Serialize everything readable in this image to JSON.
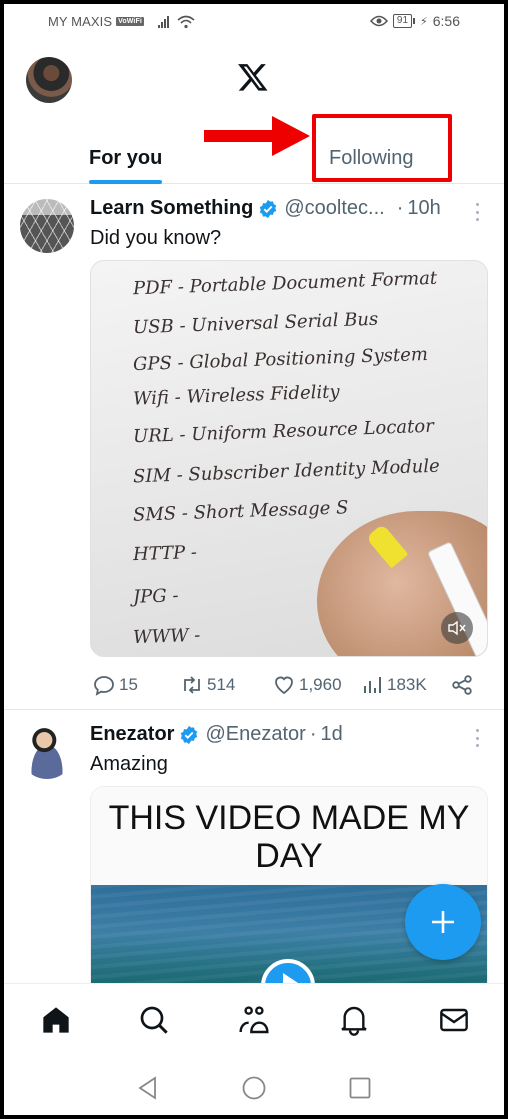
{
  "status_bar": {
    "carrier": "MY MAXIS",
    "vowifi_badge": "VoWiFi",
    "battery": "91",
    "time": "6:56"
  },
  "header": {
    "logo": "x-logo-icon",
    "tabs": [
      {
        "label": "For you",
        "active": true
      },
      {
        "label": "Following",
        "active": false,
        "highlighted": true
      }
    ],
    "annotation": {
      "arrow_color": "#ee0000",
      "box_color": "#ee0000"
    }
  },
  "tweets": [
    {
      "name": "Learn Something",
      "verified": true,
      "handle": "@cooltec...",
      "separator": "·",
      "time": "10h",
      "text": "Did you know?",
      "media": {
        "type": "video",
        "handwritten_lines": [
          "PDF - Portable Document Format",
          "USB - Universal Serial Bus",
          "GPS - Global Positioning System",
          "Wifi - Wireless Fidelity",
          "URL - Uniform Resource Locator",
          "SIM - Subscriber Identity Module",
          "SMS - Short Message S",
          "HTTP -",
          "JPG -",
          "WWW -"
        ],
        "muted": true
      },
      "actions": {
        "replies": "15",
        "reposts": "514",
        "likes": "1,960",
        "views": "183K"
      }
    },
    {
      "name": "Enezator",
      "verified": true,
      "handle": "@Enezator",
      "separator": "·",
      "time": "1d",
      "text": "Amazing",
      "media": {
        "type": "video",
        "caption": "THIS VIDEO MADE MY DAY"
      }
    }
  ],
  "fab": {
    "icon": "plus-icon"
  },
  "bottom_nav": [
    {
      "icon": "home-icon",
      "active": true
    },
    {
      "icon": "search-icon",
      "active": false
    },
    {
      "icon": "communities-icon",
      "active": false
    },
    {
      "icon": "bell-icon",
      "active": false
    },
    {
      "icon": "mail-icon",
      "active": false
    }
  ],
  "system_nav": [
    "back",
    "home",
    "recents"
  ],
  "colors": {
    "accent": "#1d9bf0",
    "text": "#0f1419",
    "secondary": "#536471"
  }
}
